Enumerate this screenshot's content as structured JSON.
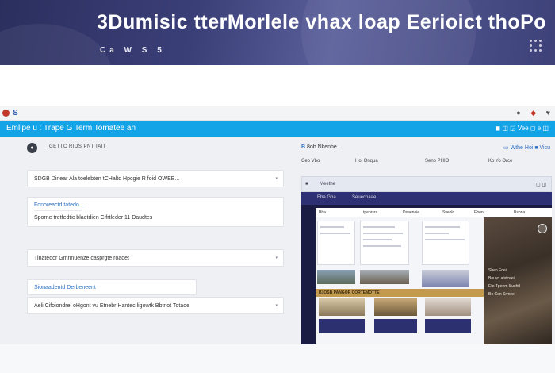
{
  "hero": {
    "title": "3Dumisic  tterMorlele vhax loap Eerioict thoPo",
    "subtitle": "Ca  W S 5"
  },
  "window": {
    "titlebar_label": "S",
    "header_title": "Emlipe u : Trape G  Term Tomatee an",
    "header_right": "◼ ◫ ◲ Vee ◻ e ◫"
  },
  "left_panel": {
    "head_badge": "●",
    "head_text": "GETTC RIDS PNT IAIT",
    "cards": [
      {
        "text": "SDGB Dinear Ala toelebten tCHaltd Hpcgie R foid OWEE..."
      },
      {
        "text_top": "Fonoreactd tatedo...",
        "text": "Sporne tretfedtic blaetdien Cifrtleder 11 Daudtes"
      },
      {
        "text": "Tinatedor Gmnnuenze casprgte roadet"
      },
      {
        "text_top": "Sionaadentd Derbeneent",
        "text": "Aeli Cifoiondrel oHgont vu Etnebr Hantec ligowtk Bbtrlot Totaoe"
      }
    ]
  },
  "right_panel": {
    "head_prefix": "B",
    "head_text": "8ob Nkenhe",
    "head_right": "▭ Wthe Hoi ■ Vicu",
    "row": [
      "Ceo Vbo",
      "Hoi Onqua",
      "Seno PHIO",
      "Ko Yo Orce"
    ],
    "tab": [
      "■",
      "Meethe",
      "▢ ◫"
    ],
    "preview": {
      "top": [
        "Eba Gba",
        "Seuecnaae"
      ],
      "nav": [
        "Bha",
        "tpenrsra",
        "Dsaenoie",
        "Sveolo",
        "Ehonr",
        "Bsona"
      ],
      "strip": "B1OSB PANGOR CORTEMOTTE",
      "side_labels": [
        "Sbeo Foei",
        "Bouyo atstceei",
        "Eto Tpeem Suehtl",
        "Bo Cen Srmee"
      ]
    }
  },
  "colors": {
    "accent": "#13a4e8",
    "hero": "#3b3f78",
    "alert": "#c0392b"
  },
  "icons": [
    "search-icon",
    "heart-icon",
    "shield-icon",
    "chevron-down-icon"
  ]
}
